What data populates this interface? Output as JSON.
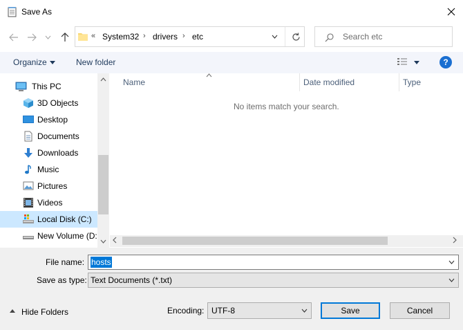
{
  "window": {
    "title": "Save As",
    "close_icon": "close-icon"
  },
  "nav": {
    "back_icon": "back-arrow-icon",
    "forward_icon": "forward-arrow-icon",
    "recent_icon": "chevron-down-icon",
    "up_icon": "up-arrow-icon"
  },
  "address": {
    "overflow": "«",
    "crumbs": [
      "System32",
      "drivers",
      "etc"
    ],
    "separator": "›",
    "refresh_icon": "refresh-icon"
  },
  "search": {
    "placeholder": "Search etc"
  },
  "toolbar": {
    "organize": "Organize",
    "new_folder": "New folder",
    "view_icon": "view-details-icon",
    "help": "?"
  },
  "sidebar": {
    "items": [
      {
        "label": "This PC",
        "icon": "computer-icon",
        "selected": false
      },
      {
        "label": "3D Objects",
        "icon": "cube-icon",
        "selected": false
      },
      {
        "label": "Desktop",
        "icon": "desktop-icon",
        "selected": false
      },
      {
        "label": "Documents",
        "icon": "document-icon",
        "selected": false
      },
      {
        "label": "Downloads",
        "icon": "download-icon",
        "selected": false
      },
      {
        "label": "Music",
        "icon": "music-icon",
        "selected": false
      },
      {
        "label": "Pictures",
        "icon": "pictures-icon",
        "selected": false
      },
      {
        "label": "Videos",
        "icon": "videos-icon",
        "selected": false
      },
      {
        "label": "Local Disk (C:)",
        "icon": "drive-icon",
        "selected": true
      },
      {
        "label": "New Volume (D:",
        "icon": "drive-icon",
        "selected": false
      }
    ]
  },
  "files": {
    "columns": [
      "Name",
      "Date modified",
      "Type"
    ],
    "empty_message": "No items match your search."
  },
  "form": {
    "file_name_label": "File name:",
    "file_name_value": "hosts",
    "save_type_label": "Save as type:",
    "save_type_value": "Text Documents (*.txt)",
    "hide_folders": "Hide Folders",
    "encoding_label": "Encoding:",
    "encoding_value": "UTF-8",
    "save": "Save",
    "cancel": "Cancel"
  },
  "colors": {
    "accent": "#0078d7",
    "selected_bg": "#cce8ff",
    "link_text": "#1e395b"
  }
}
